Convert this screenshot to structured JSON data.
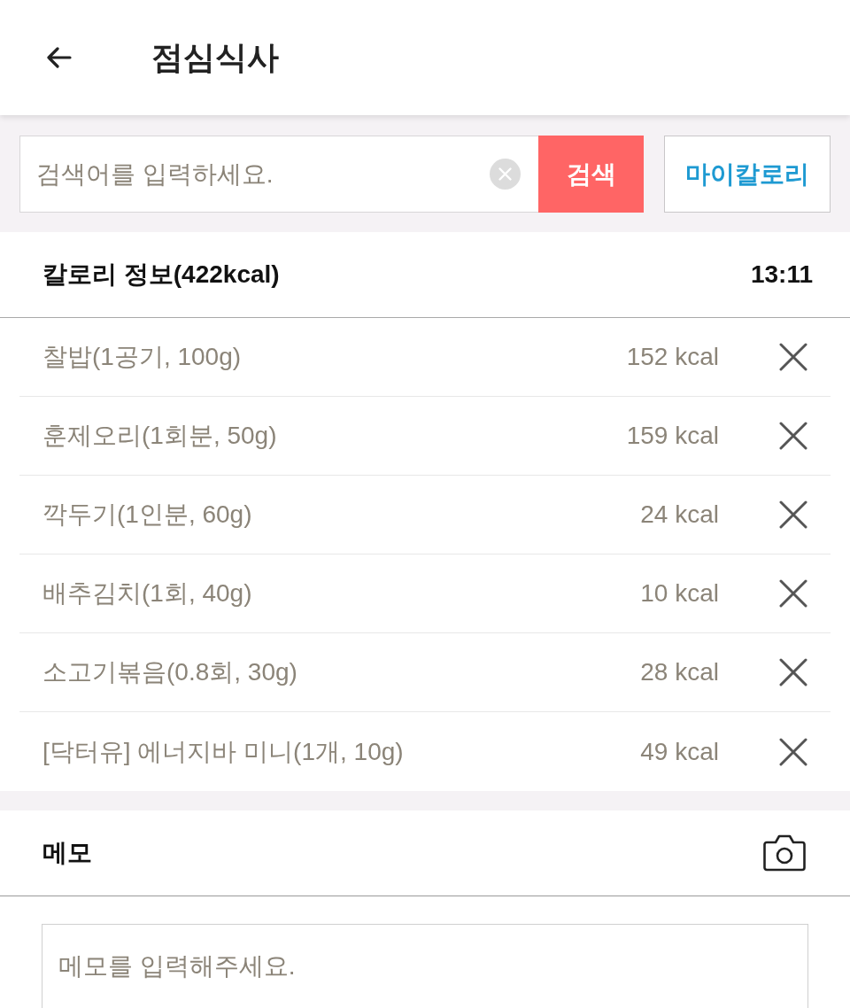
{
  "header": {
    "title": "점심식사"
  },
  "search": {
    "placeholder": "검색어를 입력하세요.",
    "button": "검색",
    "my_calorie_button": "마이칼로리"
  },
  "calorie_info": {
    "title": "칼로리 정보(422kcal)",
    "time": "13:11",
    "items": [
      {
        "name": "찰밥(1공기, 100g)",
        "calories": "152 kcal"
      },
      {
        "name": "훈제오리(1회분, 50g)",
        "calories": "159 kcal"
      },
      {
        "name": "깍두기(1인분, 60g)",
        "calories": "24 kcal"
      },
      {
        "name": "배추김치(1회, 40g)",
        "calories": "10 kcal"
      },
      {
        "name": "소고기볶음(0.8회, 30g)",
        "calories": "28 kcal"
      },
      {
        "name": "[닥터유] 에너지바 미니(1개, 10g)",
        "calories": "49 kcal"
      }
    ]
  },
  "memo": {
    "title": "메모",
    "placeholder": "메모를 입력해주세요."
  }
}
